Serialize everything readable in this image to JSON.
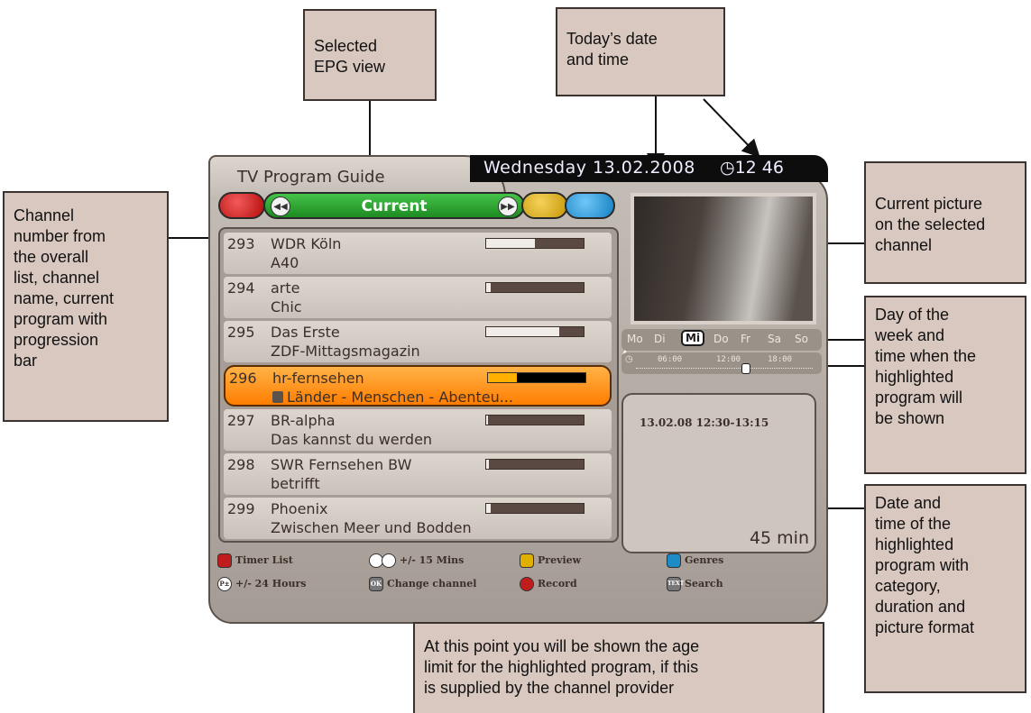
{
  "callouts": {
    "epg_view": "Selected\nEPG view",
    "date_time": "Today’s date\nand time",
    "channel_number": "Channel\nnumber from\nthe overall\nlist, channel\nname, current\nprogram with\nprogression\nbar",
    "current_picture": "Current picture\non the selected\nchannel",
    "day_of_week": "Day of the\nweek and\ntime when the\nhighlighted\nprogram will\nbe shown",
    "date_and_time": "Date and\ntime of the\nhighlighted\nprogram with\ncategory,\nduration and\npicture format",
    "age_limit": "At this point you will be shown the age\nlimit for the highlighted program, if this\nis supplied by the channel provider"
  },
  "tv": {
    "title": "TV Program Guide",
    "date": "Wednesday 13.02.2008",
    "clock": "12 46",
    "view": "Current",
    "channels": [
      {
        "number": "293",
        "name": "WDR Köln",
        "program": "A40",
        "progress": 0.5
      },
      {
        "number": "294",
        "name": "arte",
        "program": "Chic",
        "progress": 0.05
      },
      {
        "number": "295",
        "name": "Das Erste",
        "program": "ZDF-Mittagsmagazin",
        "progress": 0.75
      },
      {
        "number": "296",
        "name": "hr-fernsehen",
        "program": "Länder - Menschen - Abenteu...",
        "progress": 0.3
      },
      {
        "number": "297",
        "name": "BR-alpha",
        "program": "Das kannst du werden",
        "progress": 0.02
      },
      {
        "number": "298",
        "name": "SWR Fernsehen BW",
        "program": "betrifft",
        "progress": 0.03
      },
      {
        "number": "299",
        "name": "Phoenix",
        "program": "Zwischen Meer und Bodden",
        "progress": 0.05
      }
    ],
    "days": [
      "Mo",
      "Di",
      "Mi",
      "Do",
      "Fr",
      "Sa",
      "So"
    ],
    "current_day": "Mi",
    "time_ticks": [
      "06:00",
      "12:00",
      "18:00"
    ],
    "info_date": "13.02.08 12:30-13:15",
    "duration": "45 min",
    "legend": {
      "timer_list": "Timer List",
      "mins": "+/- 15 Mins",
      "preview": "Preview",
      "genres": "Genres",
      "hours": "+/- 24 Hours",
      "change_channel": "Change channel",
      "record": "Record",
      "search": "Search",
      "ok_key": "OK",
      "text_key": "TEXT",
      "p_key": "P±"
    }
  }
}
